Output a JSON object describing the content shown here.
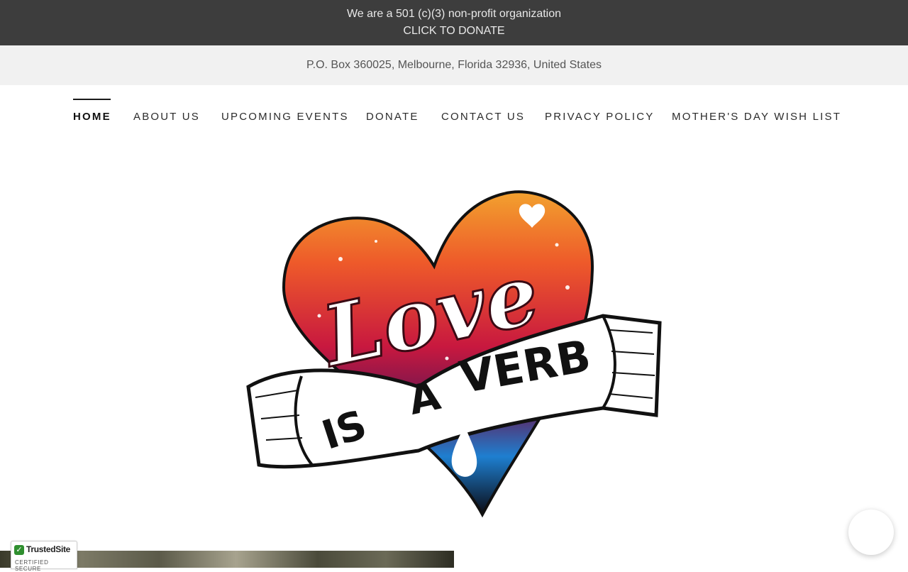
{
  "announcement": {
    "line1": "We are a 501 (c)(3) non-profit organization",
    "line2": "CLICK TO DONATE"
  },
  "address": "P.O. Box 360025, Melbourne, Florida 32936, United States",
  "nav": {
    "items": [
      {
        "label": "HOME",
        "active": true
      },
      {
        "label": "ABOUT US"
      },
      {
        "label": "UPCOMING EVENTS"
      },
      {
        "label": "DONATE"
      },
      {
        "label": "CONTACT US"
      },
      {
        "label": "PRIVACY POLICY"
      },
      {
        "label": "MOTHER'S DAY WISH LIST"
      }
    ]
  },
  "logo": {
    "word1": "Love",
    "word2": "IS",
    "word3": "A",
    "word4": "VERB"
  },
  "badge": {
    "title": "TrustedSite",
    "subtitle": "CERTIFIED SECURE"
  },
  "colors": {
    "topbar": "#3d3d3d",
    "addressbar": "#f1f1f1",
    "heart_top": "#f2a12e",
    "heart_mid": "#c8183f",
    "heart_bottom": "#1e7fd0"
  }
}
